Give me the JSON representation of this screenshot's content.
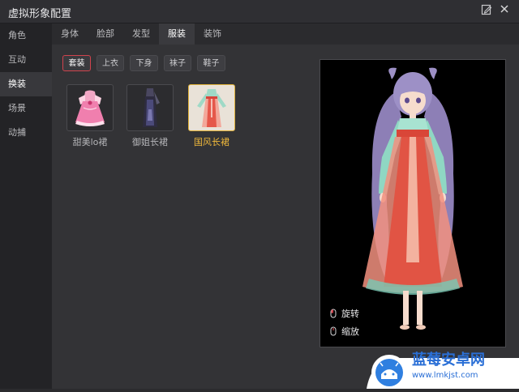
{
  "window": {
    "title": "虚拟形象配置"
  },
  "sidebar": {
    "items": [
      {
        "label": "角色"
      },
      {
        "label": "互动"
      },
      {
        "label": "换装"
      },
      {
        "label": "场景"
      },
      {
        "label": "动捕"
      }
    ],
    "active_index": 2
  },
  "tabs": [
    {
      "label": "身体"
    },
    {
      "label": "脸部"
    },
    {
      "label": "发型"
    },
    {
      "label": "服装"
    },
    {
      "label": "装饰"
    }
  ],
  "active_tab_index": 3,
  "subtabs": [
    {
      "label": "套装"
    },
    {
      "label": "上衣"
    },
    {
      "label": "下身"
    },
    {
      "label": "袜子"
    },
    {
      "label": "鞋子"
    }
  ],
  "active_subtab_index": 0,
  "outfits": [
    {
      "label": "甜美lo裙",
      "icon": "pink-lolita-dress-icon"
    },
    {
      "label": "御姐长裙",
      "icon": "dark-long-dress-icon"
    },
    {
      "label": "国风长裙",
      "icon": "hanfu-dress-icon"
    }
  ],
  "selected_outfit_index": 2,
  "preview": {
    "hints": [
      {
        "label": "旋转",
        "icon": "rotate-mouse-icon"
      },
      {
        "label": "缩放",
        "icon": "zoom-mouse-icon"
      }
    ]
  },
  "watermark": {
    "brand": "蓝莓安卓网",
    "url": "www.lmkjst.com"
  },
  "colors": {
    "accent_red": "#d0434d",
    "accent_gold": "#f1b93b",
    "preview_bg": "#000000"
  }
}
